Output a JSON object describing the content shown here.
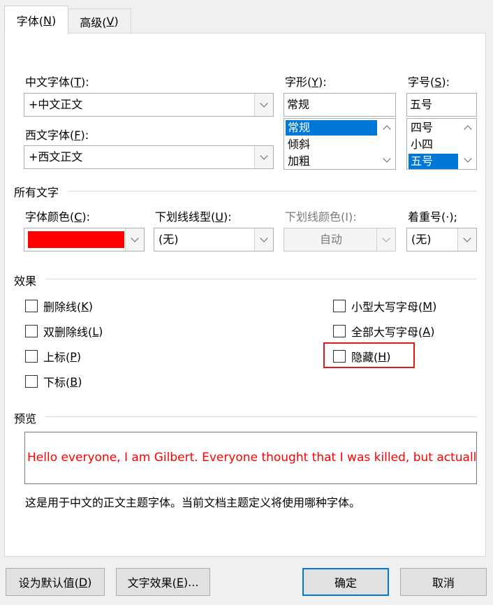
{
  "tabs": [
    {
      "label": "字体(",
      "key": "N",
      "suffix": ")"
    },
    {
      "label": "高级(",
      "key": "V",
      "suffix": ")"
    }
  ],
  "chinese_font": {
    "label": "中文字体(",
    "key": "T",
    "suffix": "):",
    "value": "+中文正文"
  },
  "western_font": {
    "label": "西文字体(",
    "key": "F",
    "suffix": "):",
    "value": "+西文正文"
  },
  "font_style": {
    "label": "字形(",
    "key": "Y",
    "suffix": "):",
    "value": "常规",
    "items": [
      "常规",
      "倾斜",
      "加粗"
    ],
    "selected": "常规"
  },
  "font_size": {
    "label": "字号(",
    "key": "S",
    "suffix": "):",
    "value": "五号",
    "items": [
      "四号",
      "小四",
      "五号"
    ],
    "selected": "五号"
  },
  "all_text": {
    "title": "所有文字",
    "font_color": {
      "label": "字体颜色(",
      "key": "C",
      "suffix": "):",
      "color": "#ff0000"
    },
    "underline_style": {
      "label": "下划线线型(",
      "key": "U",
      "suffix": "):",
      "value": "(无)"
    },
    "underline_color": {
      "label": "下划线颜色(I):",
      "value": "自动"
    },
    "emphasis": {
      "label": "着重号(·);",
      "value": "(无)"
    }
  },
  "effects": {
    "title": "效果",
    "strikethrough": {
      "label": "删除线(",
      "key": "K",
      "suffix": ")"
    },
    "double_strikethrough": {
      "label": "双删除线(",
      "key": "L",
      "suffix": ")"
    },
    "superscript": {
      "label": "上标(",
      "key": "P",
      "suffix": ")"
    },
    "subscript": {
      "label": "下标(",
      "key": "B",
      "suffix": ")"
    },
    "small_caps": {
      "label": "小型大写字母(",
      "key": "M",
      "suffix": ")"
    },
    "all_caps": {
      "label": "全部大写字母(",
      "key": "A",
      "suffix": ")"
    },
    "hidden": {
      "label": "隐藏(",
      "key": "H",
      "suffix": ")"
    },
    "highlight_color": "#e01a1a"
  },
  "preview": {
    "title": "预览",
    "text": "Hello everyone, I am Gilbert. Everyone thought that I was killed, but actually I am alive",
    "text_color": "#ff0000",
    "description": "这是用于中文的正文主题字体。当前文档主题定义将使用哪种字体。"
  },
  "buttons": {
    "set_default": {
      "label": "设为默认值(",
      "key": "D",
      "suffix": ")"
    },
    "text_effects": {
      "label": "文字效果(",
      "key": "E",
      "suffix": ")..."
    },
    "ok": "确定",
    "cancel": "取消"
  },
  "colors": {
    "accent": "#0078d7",
    "window_bg": "#f0f0f0"
  }
}
